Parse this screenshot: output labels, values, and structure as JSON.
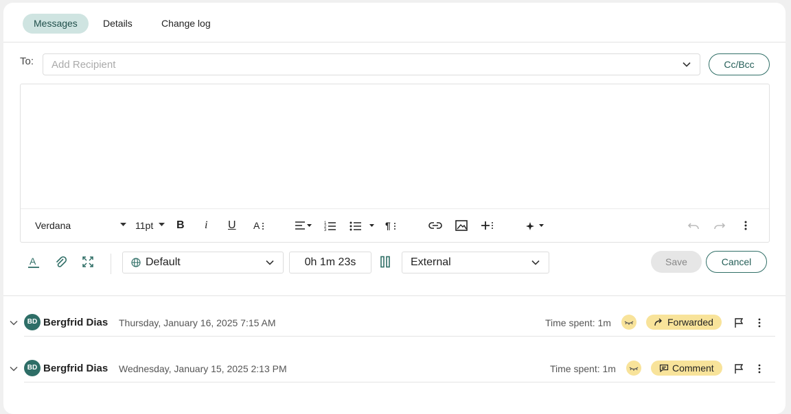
{
  "tabs": [
    {
      "label": "Messages",
      "active": true
    },
    {
      "label": "Details",
      "active": false
    },
    {
      "label": "Change log",
      "active": false
    }
  ],
  "compose": {
    "to_label": "To:",
    "recipient_placeholder": "Add Recipient",
    "ccbcc_label": "Cc/Bcc"
  },
  "toolbar": {
    "font": "Verdana",
    "size": "11pt"
  },
  "controls": {
    "language": "Default",
    "timer": "0h 1m 23s",
    "visibility": "External",
    "save_label": "Save",
    "cancel_label": "Cancel"
  },
  "messages": [
    {
      "initials": "BD",
      "sender": "Bergfrid Dias",
      "date": "Thursday, January 16, 2025 7:15 AM",
      "time_spent": "Time spent: 1m",
      "badge": "Forwarded"
    },
    {
      "initials": "BD",
      "sender": "Bergfrid Dias",
      "date": "Wednesday, January 15, 2025 2:13 PM",
      "time_spent": "Time spent: 1m",
      "badge": "Comment"
    }
  ],
  "colors": {
    "accent": "#2f6e66",
    "tab_active_bg": "#cfe4e1",
    "badge_bg": "#f8e39a"
  }
}
